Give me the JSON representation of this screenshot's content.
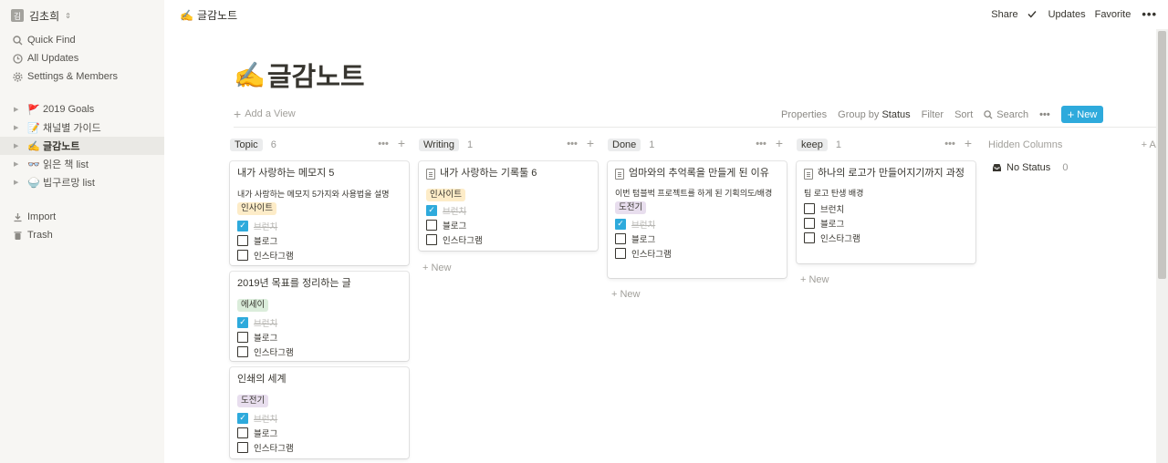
{
  "sidebar": {
    "workspace": {
      "avatar": "김",
      "name": "김초희",
      "chevron": "⇕"
    },
    "nav": [
      {
        "label": "Quick Find",
        "icon": "search-icon"
      },
      {
        "label": "All Updates",
        "icon": "clock-icon"
      },
      {
        "label": "Settings & Members",
        "icon": "gear-icon"
      }
    ],
    "pages": [
      {
        "label": "2019 Goals",
        "emoji": "🚩"
      },
      {
        "label": "채널별 가이드",
        "emoji": "📝"
      },
      {
        "label": "글감노트",
        "emoji": "✍️"
      },
      {
        "label": "읽은 책 list",
        "emoji": "👓"
      },
      {
        "label": "빕구르망 list",
        "emoji": "🍚"
      }
    ],
    "bottom": [
      {
        "label": "Import",
        "icon": "download-icon"
      },
      {
        "label": "Trash",
        "icon": "trash-icon"
      }
    ]
  },
  "topbar": {
    "breadcrumb": {
      "emoji": "✍️",
      "label": "글감노트"
    },
    "share": "Share",
    "updates": "Updates",
    "favorite": "Favorite",
    "more": "•••"
  },
  "page": {
    "emoji": "✍️",
    "title": "글감노트"
  },
  "viewbar": {
    "add_view": "Add a View",
    "properties": "Properties",
    "group_by": "Group by",
    "group_value": "Status",
    "filter": "Filter",
    "sort": "Sort",
    "search": "Search",
    "more": "•••",
    "new": "New"
  },
  "colors": {
    "accent": "#2eaadc",
    "sidebar_bg": "#f7f6f3"
  },
  "board": {
    "columns": [
      {
        "name": "Topic",
        "count": "6",
        "tag_bg": "#ebeced",
        "cards": [
          {
            "title": "내가 사랑하는 메모지 5",
            "desc": "내가 사랑하는 메모지 5가지와 사용법을 설명",
            "tag": "인사이트",
            "tag_bg": "#fdecc8",
            "checks": [
              {
                "label": "브런치",
                "checked": true
              },
              {
                "label": "블로그",
                "checked": false
              },
              {
                "label": "인스타그램",
                "checked": false
              }
            ]
          },
          {
            "title": "2019년 목표를 정리하는 글",
            "tag": "에세이",
            "tag_bg": "#dbeddb",
            "checks": [
              {
                "label": "브런치",
                "checked": true
              },
              {
                "label": "블로그",
                "checked": false
              },
              {
                "label": "인스타그램",
                "checked": false
              }
            ]
          },
          {
            "title": "인쇄의 세계",
            "tag": "도전기",
            "tag_bg": "#e8deee",
            "checks": [
              {
                "label": "브런치",
                "checked": true
              },
              {
                "label": "블로그",
                "checked": false
              },
              {
                "label": "인스타그램",
                "checked": false
              }
            ]
          }
        ]
      },
      {
        "name": "Writing",
        "count": "1",
        "tag_bg": "#fbecdd",
        "cards": [
          {
            "title": "내가 사랑하는 기록툴 6",
            "tag": "인사이트",
            "tag_bg": "#fdecc8",
            "checks": [
              {
                "label": "브런치",
                "checked": true
              },
              {
                "label": "블로그",
                "checked": false
              },
              {
                "label": "인스타그램",
                "checked": false
              }
            ]
          }
        ],
        "new": "New"
      },
      {
        "name": "Done",
        "count": "1",
        "tag_bg": "#ebeced",
        "cards": [
          {
            "title": "엄마와의 추억록을 만들게 된 이유",
            "desc": "이번 텀블벅 프로젝트를 하게 된 기획의도/배경",
            "tag": "도전기",
            "tag_bg": "#e8deee",
            "checks": [
              {
                "label": "브런치",
                "checked": true
              },
              {
                "label": "블로그",
                "checked": false
              },
              {
                "label": "인스타그램",
                "checked": false
              }
            ]
          }
        ],
        "new": "New"
      },
      {
        "name": "keep",
        "count": "1",
        "tag_bg": "#ebeced",
        "cards": [
          {
            "title": "하나의 로고가 만들어지기까지 과정",
            "desc": "팀 로고 탄생 배경",
            "checks": [
              {
                "label": "브런치",
                "checked": false
              },
              {
                "label": "블로그",
                "checked": false
              },
              {
                "label": "인스타그램",
                "checked": false
              }
            ]
          }
        ],
        "new": "New"
      }
    ],
    "hidden": {
      "label": "Hidden Columns",
      "add": "+ Ad",
      "no_status": "No Status",
      "no_status_count": "0"
    }
  }
}
